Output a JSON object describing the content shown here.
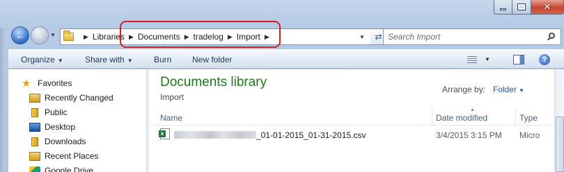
{
  "window": {
    "caption": {
      "min": "",
      "max": "",
      "close": "✕"
    }
  },
  "addressbar": {
    "breadcrumb": [
      "Libraries",
      "Documents",
      "tradelog",
      "Import"
    ],
    "search_placeholder": "Search Import"
  },
  "toolbar": {
    "organize": "Organize",
    "share_with": "Share with",
    "burn": "Burn",
    "new_folder": "New folder",
    "help": "?"
  },
  "nav": {
    "favorites_label": "Favorites",
    "items": [
      "Recently Changed",
      "Public",
      "Desktop",
      "Downloads",
      "Recent Places",
      "Google Drive"
    ]
  },
  "content": {
    "title": "Documents library",
    "subtitle": "Import",
    "arrange_label": "Arrange by:",
    "arrange_value": "Folder",
    "columns": {
      "name": "Name",
      "date": "Date modified",
      "type": "Type"
    },
    "files": [
      {
        "name_suffix": "_01-01-2015_01-31-2015.csv",
        "date": "3/4/2015 3:15 PM",
        "type": "Micro"
      }
    ]
  },
  "colors": {
    "highlight": "#e01a1a",
    "library_title": "#1e7a1e",
    "link": "#1e5aa8"
  }
}
